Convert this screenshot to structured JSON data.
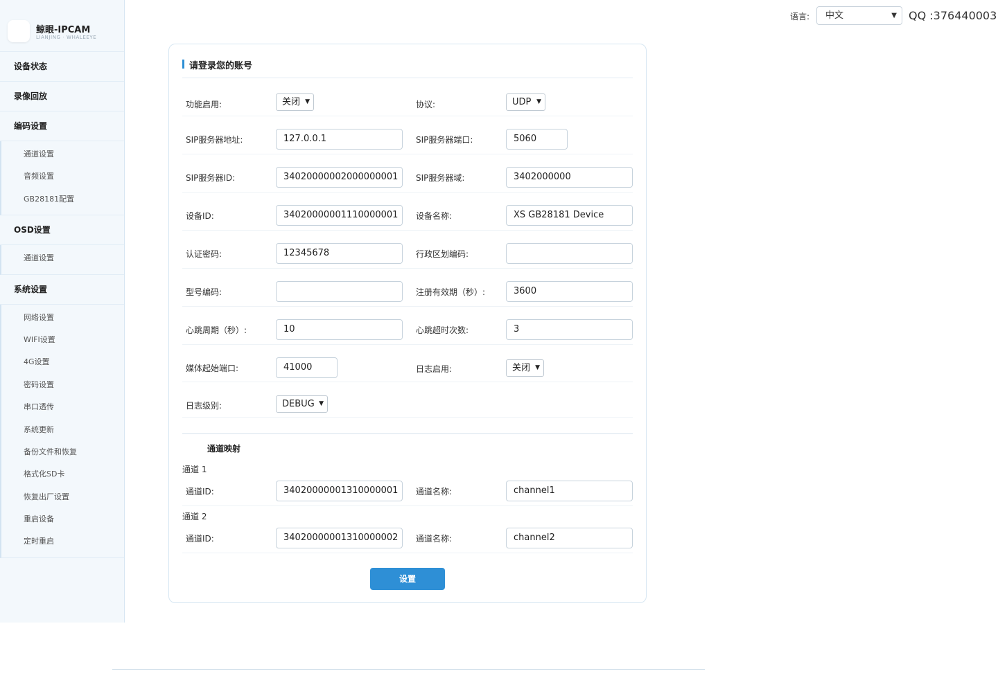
{
  "brand": {
    "title": "鲸眼-IPCAM",
    "subtitle": "LIANJING · WHALEEYE"
  },
  "sidebar": {
    "device_status": "设备状态",
    "playback": "录像回放",
    "encode": {
      "label": "编码设置",
      "items": [
        "通道设置",
        "音频设置",
        "GB28181配置"
      ]
    },
    "osd": {
      "label": "OSD设置",
      "items": [
        "通道设置"
      ]
    },
    "system": {
      "label": "系统设置",
      "items": [
        "网络设置",
        "WIFI设置",
        "4G设置",
        "密码设置",
        "串口透传",
        "系统更新",
        "备份文件和恢复",
        "格式化SD卡",
        "恢复出厂设置",
        "重启设备",
        "定时重启"
      ]
    }
  },
  "header": {
    "lang_label": "语言:",
    "lang_value": "中文",
    "qq": "QQ :376440003"
  },
  "panel": {
    "title": "请登录您的账号"
  },
  "form": {
    "enable": {
      "label": "功能启用:",
      "value": "关闭"
    },
    "protocol": {
      "label": "协议:",
      "value": "UDP"
    },
    "sip_addr": {
      "label": "SIP服务器地址:",
      "value": "127.0.0.1"
    },
    "sip_port": {
      "label": "SIP服务器端口:",
      "value": "5060"
    },
    "sip_id": {
      "label": "SIP服务器ID:",
      "value": "34020000002000000001"
    },
    "sip_domain": {
      "label": "SIP服务器域:",
      "value": "3402000000"
    },
    "device_id": {
      "label": "设备ID:",
      "value": "34020000001110000001"
    },
    "device_name": {
      "label": "设备名称:",
      "value": "XS GB28181 Device"
    },
    "auth_pwd": {
      "label": "认证密码:",
      "value": "12345678"
    },
    "region_code": {
      "label": "行政区划编码:",
      "value": ""
    },
    "model_code": {
      "label": "型号编码:",
      "value": ""
    },
    "reg_expire": {
      "label": "注册有效期（秒）:",
      "value": "3600"
    },
    "heartbeat": {
      "label": "心跳周期（秒）:",
      "value": "10"
    },
    "hb_timeout": {
      "label": "心跳超时次数:",
      "value": "3"
    },
    "media_port": {
      "label": "媒体起始端口:",
      "value": "41000"
    },
    "log_enable": {
      "label": "日志启用:",
      "value": "关闭"
    },
    "log_level": {
      "label": "日志级别:",
      "value": "DEBUG"
    }
  },
  "channel_map": {
    "title": "通道映射",
    "channels": [
      {
        "title": "通道 1",
        "id_label": "通道ID:",
        "id": "34020000001310000001",
        "name_label": "通道名称:",
        "name": "channel1"
      },
      {
        "title": "通道 2",
        "id_label": "通道ID:",
        "id": "34020000001310000002",
        "name_label": "通道名称:",
        "name": "channel2"
      }
    ]
  },
  "submit_label": "设置"
}
